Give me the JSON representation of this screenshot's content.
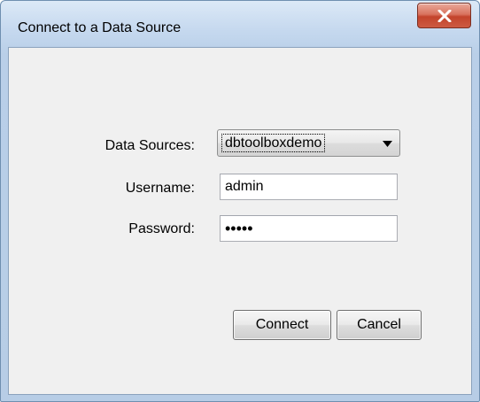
{
  "window": {
    "title": "Connect to a Data Source",
    "close_label": "x"
  },
  "form": {
    "data_sources_label": "Data Sources:",
    "data_sources_value": "dbtoolboxdemo",
    "username_label": "Username:",
    "username_value": "admin",
    "password_label": "Password:",
    "password_value": "•••••"
  },
  "buttons": {
    "connect_label": "Connect",
    "cancel_label": "Cancel"
  },
  "colors": {
    "title_bar": "#c6d9ef",
    "close_button": "#c3442c",
    "client_bg": "#f0f0f0"
  }
}
